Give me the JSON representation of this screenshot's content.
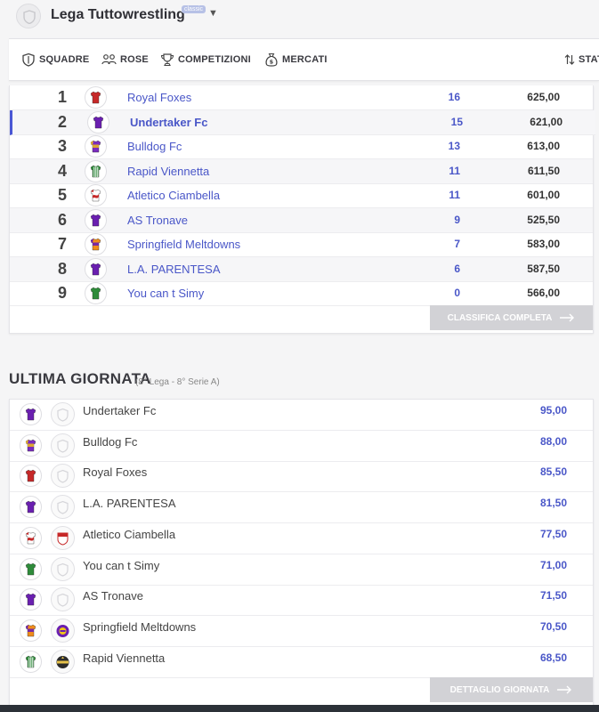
{
  "header": {
    "league_name": "Lega Tuttowrestling",
    "badge": "classic"
  },
  "menu": [
    {
      "label": "SQUADRE",
      "icon": "shield-icon"
    },
    {
      "label": "ROSE",
      "icon": "players-icon"
    },
    {
      "label": "COMPETIZIONI",
      "icon": "trophy-icon"
    },
    {
      "label": "MERCATI",
      "icon": "money-bag-icon"
    },
    {
      "label": "STAT",
      "icon": "sort-arrows-icon"
    }
  ],
  "standings": [
    {
      "pos": "1",
      "team": "Royal Foxes",
      "points": "16",
      "total": "625,00",
      "kit": "red"
    },
    {
      "pos": "2",
      "team": "Undertaker Fc",
      "points": "15",
      "total": "621,00",
      "kit": "purple"
    },
    {
      "pos": "3",
      "team": "Bulldog Fc",
      "points": "13",
      "total": "613,00",
      "kit": "purple-gold"
    },
    {
      "pos": "4",
      "team": "Rapid Viennetta",
      "points": "11",
      "total": "611,50",
      "kit": "green-stripes"
    },
    {
      "pos": "5",
      "team": "Atletico Ciambella",
      "points": "11",
      "total": "601,00",
      "kit": "red-white"
    },
    {
      "pos": "6",
      "team": "AS Tronave",
      "points": "9",
      "total": "525,50",
      "kit": "purple"
    },
    {
      "pos": "7",
      "team": "Springfield Meltdowns",
      "points": "7",
      "total": "583,00",
      "kit": "orange-purple"
    },
    {
      "pos": "8",
      "team": "L.A. PARENTESA",
      "points": "6",
      "total": "587,50",
      "kit": "purple"
    },
    {
      "pos": "9",
      "team": "You can t Simy",
      "points": "0",
      "total": "566,00",
      "kit": "green"
    }
  ],
  "standings_button": "CLASSIFICA COMPLETA",
  "last_round": {
    "title": "ULTIMA GIORNATA",
    "subtitle": "(8° Lega - 8° Serie A)",
    "results": [
      {
        "team": "Undertaker Fc",
        "score": "95,00",
        "kit": "purple",
        "coach": "default"
      },
      {
        "team": "Bulldog Fc",
        "score": "88,00",
        "kit": "purple-gold",
        "coach": "default"
      },
      {
        "team": "Royal Foxes",
        "score": "85,50",
        "kit": "red",
        "coach": "default"
      },
      {
        "team": "L.A. PARENTESA",
        "score": "81,50",
        "kit": "purple",
        "coach": "default"
      },
      {
        "team": "Atletico Ciambella",
        "score": "77,50",
        "kit": "red-white",
        "coach": "red-crest"
      },
      {
        "team": "You can t Simy",
        "score": "71,00",
        "kit": "green",
        "coach": "default"
      },
      {
        "team": "AS Tronave",
        "score": "71,50",
        "kit": "purple",
        "coach": "default"
      },
      {
        "team": "Springfield Meltdowns",
        "score": "70,50",
        "kit": "orange-purple",
        "coach": "purple-crest"
      },
      {
        "team": "Rapid Viennetta",
        "score": "68,50",
        "kit": "green-stripes",
        "coach": "dark-crest"
      }
    ],
    "button": "DETTAGLIO GIORNATA"
  },
  "colors": {
    "accent": "#4a57c8",
    "selected_marker": "#4a57d4",
    "button_bg": "#d2d2d6"
  }
}
